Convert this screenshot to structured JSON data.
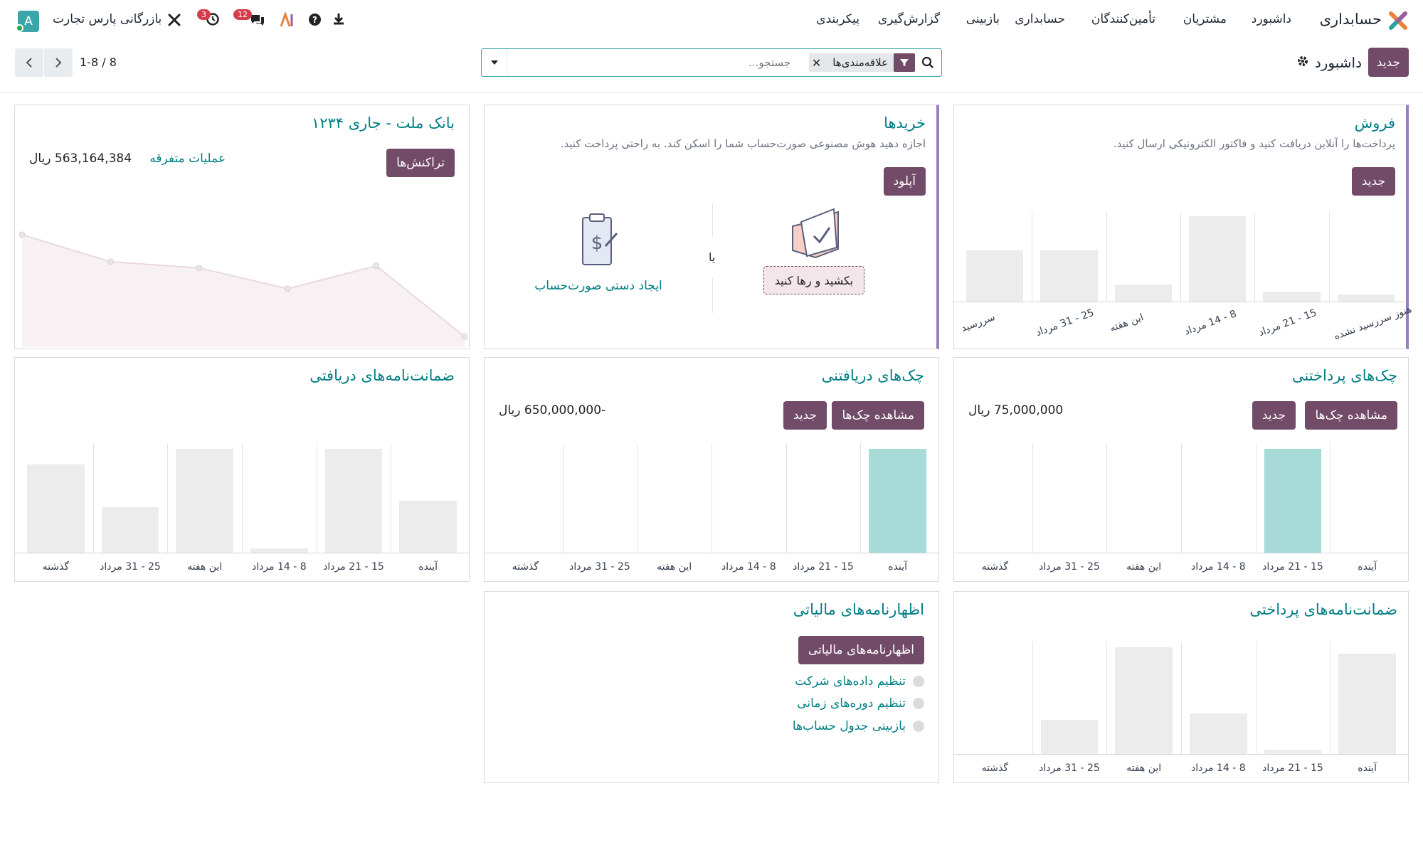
{
  "topbar": {
    "app_name": "حسابداری",
    "menu": [
      "داشبورد",
      "مشتریان",
      "تأمین‌کنندگان",
      "حسابداری",
      "بازبینی",
      "گزارش‌گیری",
      "پیکربندی"
    ],
    "company": "بازرگانی پارس تجارت",
    "messages_badge": "12",
    "activities_badge": "3",
    "avatar_letter": "A"
  },
  "control": {
    "new_button": "جدید",
    "breadcrumb": "داشبورد",
    "search_facet": "علاقه‌مندی‌ها",
    "search_placeholder": "جستجو...",
    "pager": "1-8 / 8"
  },
  "colors": {
    "accent": "#714b67",
    "link": "#017e84",
    "highlight_bar": "#a6dbd8",
    "bar": "#ececec"
  },
  "cards": {
    "sales": {
      "title": "فروش",
      "subtitle": "پرداخت‌ها را آنلاین دریافت کنید و فاکتور الکترونیکی ارسال کنید.",
      "new_button": "جدید",
      "chart_labels": [
        "هنوز سررسید نشده",
        "15 - 21 مرداد",
        "8 - 14 مرداد",
        "این هفته",
        "25 - 31 مرداد",
        "سررسید"
      ],
      "chart_values": [
        8,
        12,
        100,
        20,
        60,
        60
      ]
    },
    "purchases": {
      "title": "خریدها",
      "subtitle": "اجازه دهید هوش مصنوعی صورت‌حساب شما را اسکن کند. به راحتی پرداخت کنید.",
      "upload_button": "آپلود",
      "drag_label": "بکشید و رها کنید",
      "or_label": "یا",
      "manual_link": "ایجاد دستی صورت‌حساب"
    },
    "bank": {
      "title": "بانک ملت - جاری ۱۲۳۴",
      "transactions_button": "تراکنش‌ها",
      "misc_link": "عملیات متفرقه",
      "balance": "563,164,384 ریال",
      "line_values": [
        100,
        74,
        68,
        48,
        70,
        2
      ]
    },
    "checks_payable": {
      "title": "چک‌های پرداختنی",
      "view_button": "مشاهده چک‌ها",
      "new_button": "جدید",
      "amount": "75,000,000 ریال",
      "chart_labels": [
        "آینده",
        "15 - 21 مرداد",
        "8 - 14 مرداد",
        "این هفته",
        "25 - 31 مرداد",
        "گذشته"
      ],
      "chart_values": [
        0,
        100,
        0,
        0,
        0,
        0
      ]
    },
    "checks_receivable": {
      "title": "چک‌های دریافتنی",
      "view_button": "مشاهده چک‌ها",
      "new_button": "جدید",
      "amount": "-650,000,000 ریال",
      "chart_labels": [
        "آینده",
        "15 - 21 مرداد",
        "8 - 14 مرداد",
        "این هفته",
        "25 - 31 مرداد",
        "گذشته"
      ],
      "chart_values": [
        100,
        0,
        0,
        0,
        0,
        0
      ]
    },
    "guarantees_received": {
      "title": "ضمانت‌نامه‌های دریافتی",
      "chart_labels": [
        "آینده",
        "15 - 21 مرداد",
        "8 - 14 مرداد",
        "این هفته",
        "25 - 31 مرداد",
        "گذشته"
      ],
      "chart_values": [
        50,
        100,
        4,
        100,
        44,
        85
      ]
    },
    "tax_returns": {
      "title": "اظهارنامه‌های مالیاتی",
      "button": "اظهارنامه‌های مالیاتی",
      "steps": [
        "تنظیم داده‌های شرکت",
        "تنظیم دوره‌های زمانی",
        "بازبینی جدول حساب‌ها"
      ]
    },
    "guarantees_paid": {
      "title": "ضمانت‌نامه‌های پرداختی",
      "chart_labels": [
        "آینده",
        "15 - 21 مرداد",
        "8 - 14 مرداد",
        "این هفته",
        "25 - 31 مرداد",
        "گذشته"
      ],
      "chart_values": [
        94,
        4,
        38,
        100,
        32,
        0
      ]
    }
  }
}
